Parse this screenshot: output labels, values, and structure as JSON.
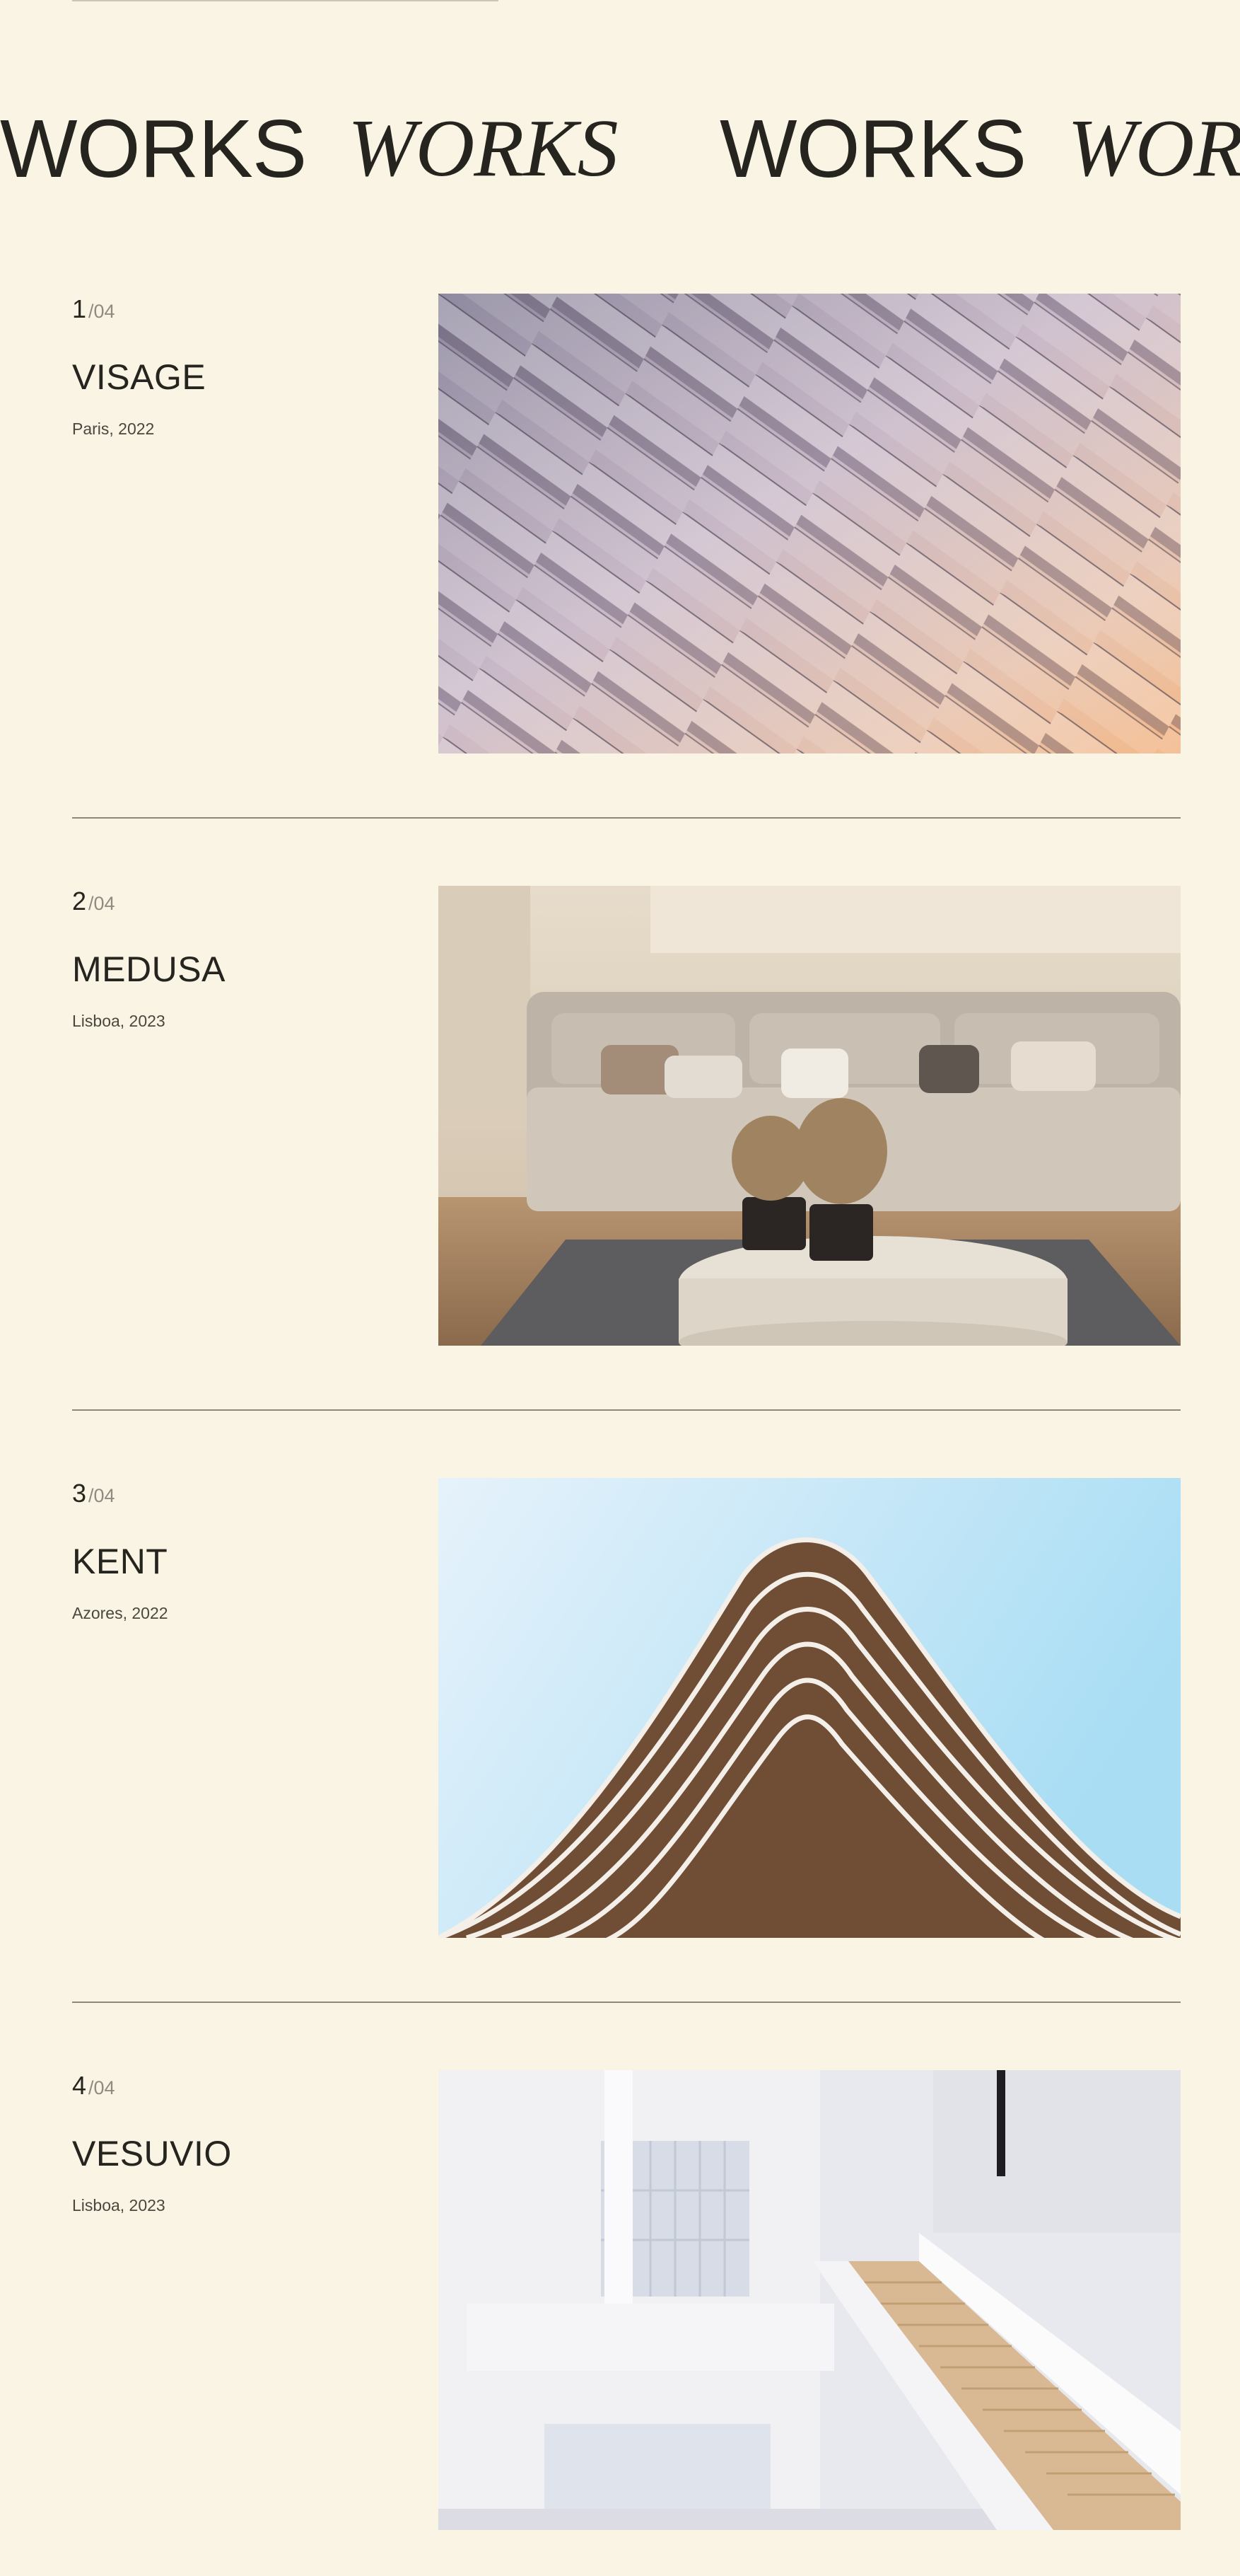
{
  "marquee": {
    "words": [
      "WORKS",
      "WORKS",
      "WORKS",
      "WORKS"
    ]
  },
  "projects": [
    {
      "number": "1",
      "total": "/04",
      "title": "VISAGE",
      "subtitle": "Paris, 2022",
      "image": "angular-metal-facade-photo"
    },
    {
      "number": "2",
      "total": "/04",
      "title": "MEDUSA",
      "subtitle": "Lisboa, 2023",
      "image": "living-room-interior-photo"
    },
    {
      "number": "3",
      "total": "/04",
      "title": "KENT",
      "subtitle": "Azores, 2022",
      "image": "curved-building-sky-photo"
    },
    {
      "number": "4",
      "total": "/04",
      "title": "VESUVIO",
      "subtitle": "Lisboa, 2023",
      "image": "white-staircase-interior-photo"
    }
  ],
  "colors": {
    "background": "#f9f4e3",
    "text": "#26241f",
    "muted": "#8f8b80",
    "divider": "#8d897e"
  }
}
